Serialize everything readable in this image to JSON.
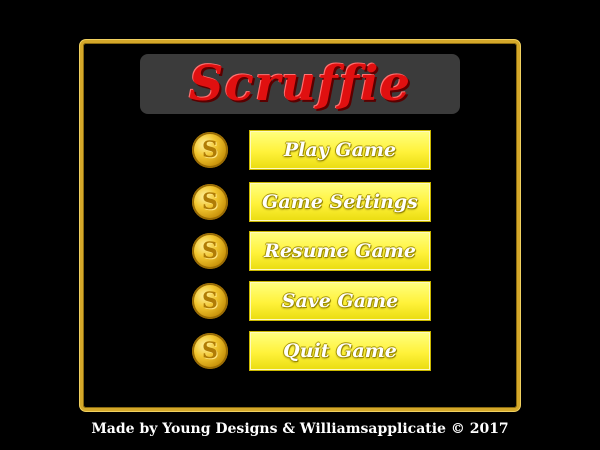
{
  "game": {
    "title": "Scruffie",
    "menu": [
      {
        "label": "Play Game"
      },
      {
        "label": "Game Settings"
      },
      {
        "label": "Resume Game"
      },
      {
        "label": "Save Game"
      },
      {
        "label": "Quit Game"
      }
    ],
    "coin_glyph": "S",
    "footer": "Made by Young Designs & Williamsapplicatie © 2017"
  },
  "colors": {
    "background": "#000000",
    "frame_gold": "#d4a82a",
    "title_bar": "#3b3b3b",
    "title_red": "#e01010",
    "button_yellow": "#fff23a",
    "button_text": "#ffffff",
    "coin_gold": "#f2c630"
  },
  "icons": {
    "menu_item_icon": "gold-coin-icon"
  }
}
